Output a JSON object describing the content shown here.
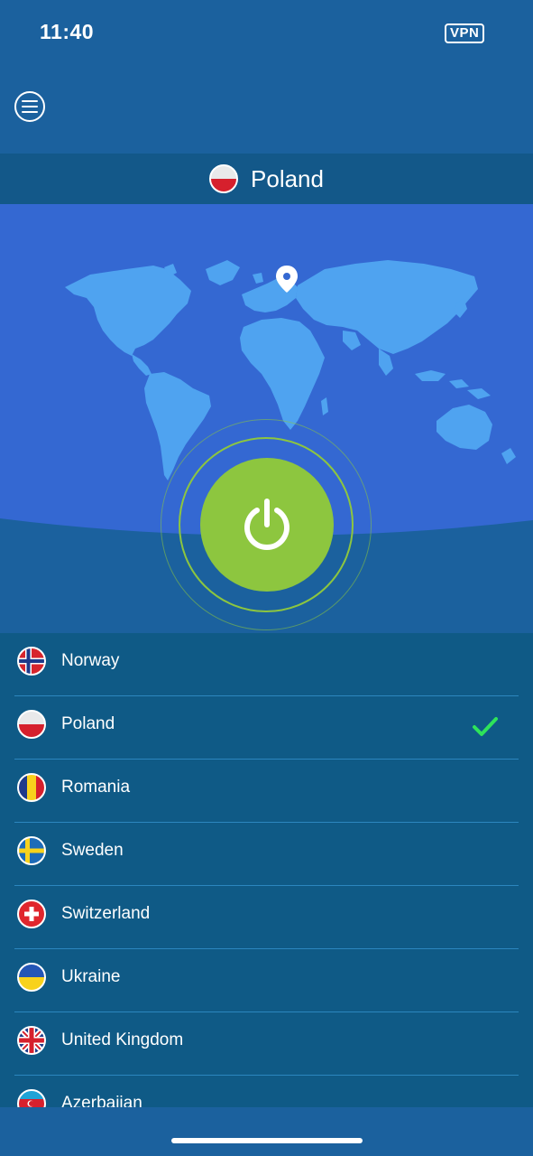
{
  "status_bar": {
    "time": "11:40",
    "vpn_badge": "VPN"
  },
  "header": {
    "menu_icon": "hamburger-menu-icon"
  },
  "selected_location": {
    "country": "Poland",
    "flag_icon": "poland-flag-icon"
  },
  "map": {
    "pin_icon": "location-pin-icon"
  },
  "connect_button": {
    "icon": "power-icon",
    "color": "#8dc63f"
  },
  "servers": [
    {
      "name": "Norway",
      "flag": "norway-flag-icon",
      "selected": false
    },
    {
      "name": "Poland",
      "flag": "poland-flag-icon",
      "selected": true
    },
    {
      "name": "Romania",
      "flag": "romania-flag-icon",
      "selected": false
    },
    {
      "name": "Sweden",
      "flag": "sweden-flag-icon",
      "selected": false
    },
    {
      "name": "Switzerland",
      "flag": "switzerland-flag-icon",
      "selected": false
    },
    {
      "name": "Ukraine",
      "flag": "ukraine-flag-icon",
      "selected": false
    },
    {
      "name": "United Kingdom",
      "flag": "united-kingdom-flag-icon",
      "selected": false
    },
    {
      "name": "Azerbaijan",
      "flag": "azerbaijan-flag-icon",
      "selected": false
    }
  ],
  "colors": {
    "background": "#1b619e",
    "list_bg": "#0f5a86",
    "map_bg": "#3468d2",
    "land": "#4fa3f0",
    "check": "#2ee35a"
  }
}
